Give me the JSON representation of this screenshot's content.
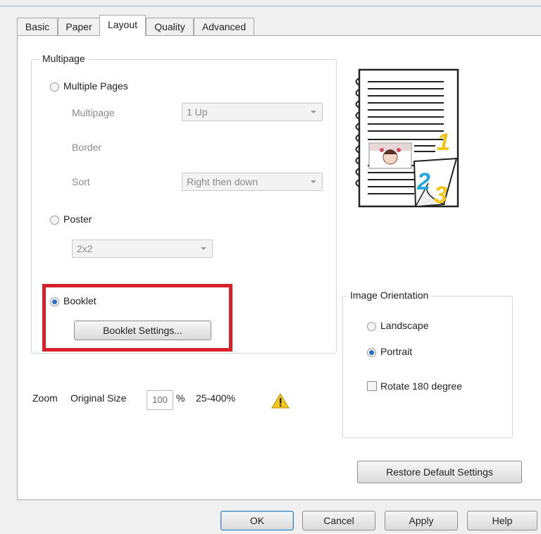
{
  "tabs": [
    {
      "label": "Basic"
    },
    {
      "label": "Paper"
    },
    {
      "label": "Layout"
    },
    {
      "label": "Quality"
    },
    {
      "label": "Advanced"
    }
  ],
  "active_tab": "Layout",
  "multipage_group": {
    "legend": "Multipage",
    "multiple_pages": {
      "label": "Multiple Pages",
      "checked": false,
      "multipage_label": "Multipage",
      "multipage_value": "1 Up",
      "border_label": "Border",
      "sort_label": "Sort",
      "sort_value": "Right then down"
    },
    "poster": {
      "label": "Poster",
      "checked": false,
      "value": "2x2"
    },
    "booklet": {
      "label": "Booklet",
      "checked": true,
      "settings_button": "Booklet Settings..."
    }
  },
  "zoom": {
    "label": "Zoom",
    "mode": "Original Size",
    "value": "100",
    "unit": "%",
    "range": "25-400%",
    "warning_icon": "warning-icon"
  },
  "preview": {
    "numbers": [
      "1",
      "2",
      "3"
    ],
    "colors": {
      "one": "#f2c51b",
      "two": "#29a8e0",
      "three": "#f2c51b"
    }
  },
  "image_orientation": {
    "legend": "Image Orientation",
    "landscape_label": "Landscape",
    "landscape_checked": false,
    "portrait_label": "Portrait",
    "portrait_checked": true,
    "rotate_label": "Rotate 180 degree",
    "rotate_checked": false
  },
  "restore_button": "Restore Default Settings",
  "footer": {
    "ok": "OK",
    "cancel": "Cancel",
    "apply": "Apply",
    "help": "Help"
  },
  "colors": {
    "accent": "#2c6fc2",
    "highlight_box": "#d6202b"
  }
}
